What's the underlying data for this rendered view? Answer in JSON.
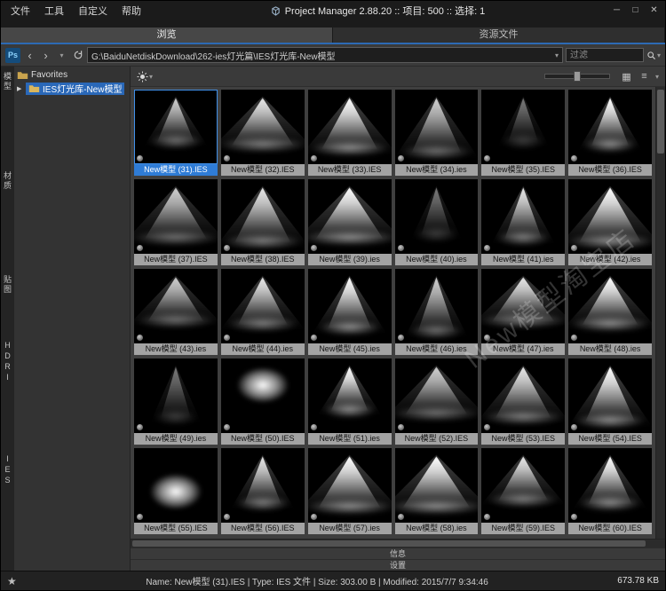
{
  "window": {
    "title": "Project Manager 2.88.20  ::  项目: 500  ::  选择: 1",
    "controls": {
      "minimize": "─",
      "maximize": "□",
      "close": "✕"
    }
  },
  "menu": [
    "文件",
    "工具",
    "自定义",
    "帮助"
  ],
  "tabs": {
    "browse": "浏览",
    "resources": "资源文件"
  },
  "toolbar": {
    "ps_label": "Ps",
    "path": "G:\\BaiduNetdiskDownload\\262-ies灯光篇\\IES灯光库-New模型",
    "filter_placeholder": "过滤"
  },
  "side_tabs": [
    "模型",
    "材质",
    "贴图",
    "HDRI",
    "IES"
  ],
  "tree": {
    "favorites": "Favorites",
    "selected_folder": "IES灯光库-New模型"
  },
  "grid": {
    "items": [
      {
        "label": "New模型 (31).IES",
        "selected": true
      },
      {
        "label": "New模型 (32).IES"
      },
      {
        "label": "New模型 (33).IES"
      },
      {
        "label": "New模型 (34).ies"
      },
      {
        "label": "New模型 (35).IES"
      },
      {
        "label": "New模型 (36).IES"
      },
      {
        "label": "New模型 (37).IES"
      },
      {
        "label": "New模型 (38).IES"
      },
      {
        "label": "New模型 (39).ies"
      },
      {
        "label": "New模型 (40).ies"
      },
      {
        "label": "New模型 (41).ies"
      },
      {
        "label": "New模型 (42).ies"
      },
      {
        "label": "New模型 (43).ies"
      },
      {
        "label": "New模型 (44).ies"
      },
      {
        "label": "New模型 (45).ies"
      },
      {
        "label": "New模型 (46).ies"
      },
      {
        "label": "New模型 (47).ies"
      },
      {
        "label": "New模型 (48).ies"
      },
      {
        "label": "New模型 (49).ies"
      },
      {
        "label": "New模型 (50).IES"
      },
      {
        "label": "New模型 (51).ies"
      },
      {
        "label": "New模型 (52).IES"
      },
      {
        "label": "New模型 (53).IES"
      },
      {
        "label": "New模型 (54).IES"
      },
      {
        "label": "New模型 (55).IES"
      },
      {
        "label": "New模型 (56).IES"
      },
      {
        "label": "New模型 (57).ies"
      },
      {
        "label": "New模型 (58).ies"
      },
      {
        "label": "New模型 (59).IES"
      },
      {
        "label": "New模型 (60).IES"
      }
    ]
  },
  "watermark": "New模型淘宝店",
  "panels": {
    "info": "信息",
    "settings": "设置"
  },
  "statusbar": {
    "item_details": "Name: New模型 (31).IES | Type: IES 文件 | Size: 303.00 B | Modified: 2015/7/7 9:34:46",
    "total_size": "673.78 KB"
  }
}
